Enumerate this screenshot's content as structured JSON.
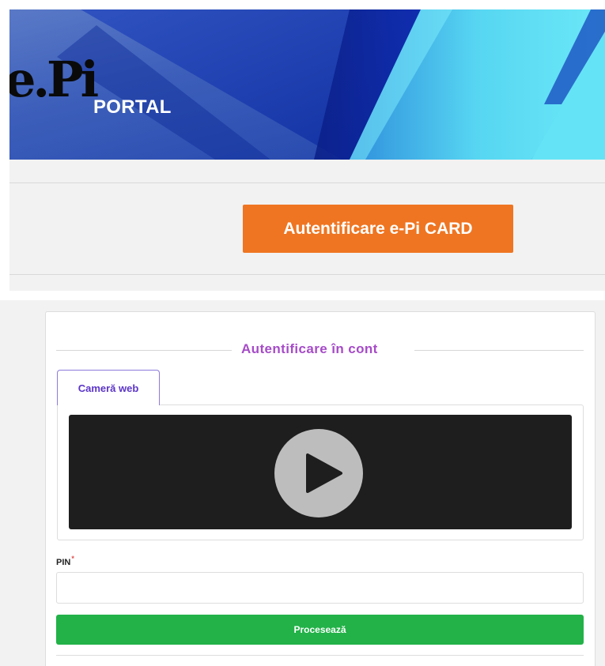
{
  "banner": {
    "logo_text": "e.Pi",
    "portal_label": "PORTAL"
  },
  "auth_card_button": {
    "label": "Autentificare e-Pi CARD"
  },
  "login_panel": {
    "title": "Autentificare în cont",
    "tab_label": "Cameră web",
    "pin_label": "PIN",
    "pin_required_marker": "*",
    "pin_value": "",
    "submit_label": "Procesează"
  },
  "colors": {
    "banner_blue": "#1f46a8",
    "banner_cyan": "#5fdcf2",
    "orange_button": "#ef7522",
    "green_button": "#22b248",
    "title_purple": "#a64bc8",
    "tab_text": "#5b34c8"
  },
  "icons": {
    "video": "play-icon"
  }
}
